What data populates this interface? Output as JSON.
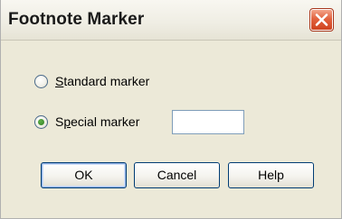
{
  "window": {
    "title": "Footnote Marker",
    "close_icon": "close-icon"
  },
  "options": {
    "standard": {
      "label_accel": "S",
      "label_rest": "tandard marker",
      "selected": false
    },
    "special": {
      "label_pre": "S",
      "label_accel": "p",
      "label_rest": "ecial marker",
      "selected": true
    }
  },
  "marker_input": {
    "value": ""
  },
  "buttons": {
    "ok": "OK",
    "cancel": "Cancel",
    "help": "Help"
  },
  "colors": {
    "dialog_bg": "#ece9d8",
    "close_button": "#e2623e",
    "radio_dot": "#2f7f22"
  }
}
